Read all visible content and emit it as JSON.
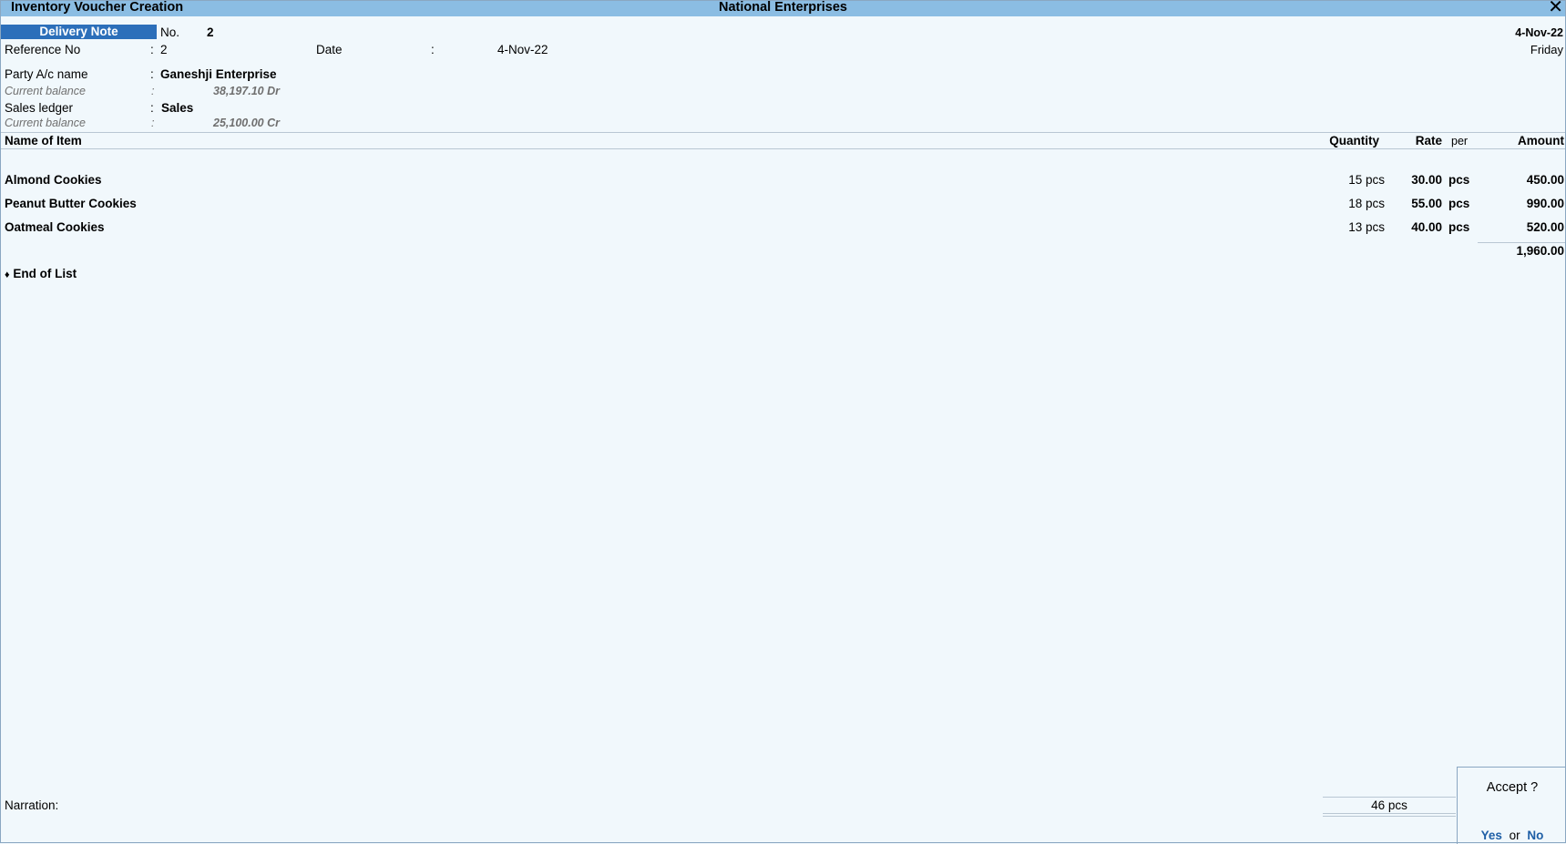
{
  "window": {
    "title": "Inventory Voucher Creation",
    "company": "National Enterprises"
  },
  "voucher": {
    "type": "Delivery Note",
    "no_label": "No.",
    "no_value": "2",
    "date_top": "4-Nov-22",
    "day": "Friday",
    "reference_label": "Reference No",
    "reference_value": "2",
    "date_label": "Date",
    "date_value": "4-Nov-22"
  },
  "party": {
    "label": "Party A/c name",
    "value": "Ganeshji Enterprise",
    "balance_label": "Current balance",
    "balance_value": "38,197.10 Dr"
  },
  "sales": {
    "label": "Sales ledger",
    "value": "Sales",
    "balance_label": "Current balance",
    "balance_value": "25,100.00 Cr"
  },
  "table": {
    "headers": {
      "name": "Name of Item",
      "quantity": "Quantity",
      "rate": "Rate",
      "per": "per",
      "amount": "Amount"
    },
    "rows": [
      {
        "name": "Almond Cookies",
        "quantity": "15 pcs",
        "rate": "30.00",
        "per": "pcs",
        "amount": "450.00"
      },
      {
        "name": "Peanut Butter Cookies",
        "quantity": "18 pcs",
        "rate": "55.00",
        "per": "pcs",
        "amount": "990.00"
      },
      {
        "name": "Oatmeal Cookies",
        "quantity": "13 pcs",
        "rate": "40.00",
        "per": "pcs",
        "amount": "520.00"
      }
    ],
    "subtotal": "1,960.00",
    "end_of_list": "End of List"
  },
  "footer": {
    "narration_label": "Narration:",
    "total_quantity": "46 pcs"
  },
  "accept": {
    "title": "Accept ?",
    "yes": "Yes",
    "or": "or",
    "no": "No"
  },
  "colors": {
    "titlebar": "#8bbde3",
    "voucher_type_bg": "#2c6fba",
    "background": "#f1f8fc"
  }
}
